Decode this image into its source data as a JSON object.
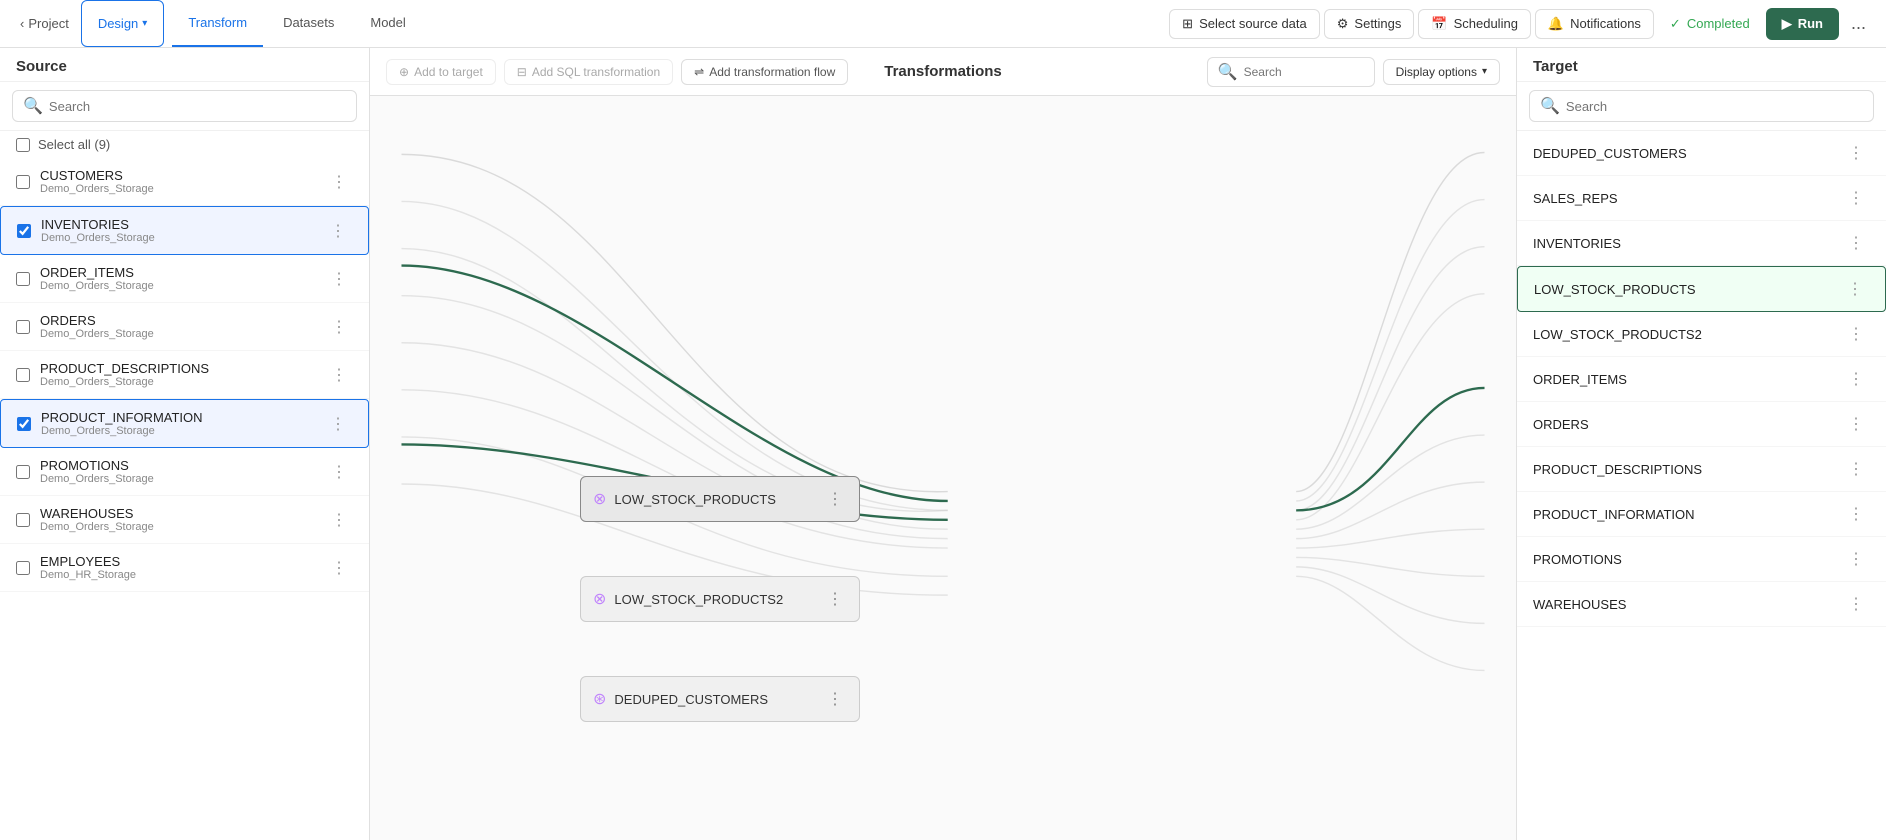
{
  "nav": {
    "back_label": "Project",
    "design_label": "Design",
    "transform_label": "Transform",
    "datasets_label": "Datasets",
    "model_label": "Model",
    "select_source_label": "Select source data",
    "settings_label": "Settings",
    "scheduling_label": "Scheduling",
    "notifications_label": "Notifications",
    "completed_label": "Completed",
    "run_label": "Run",
    "more_label": "..."
  },
  "source": {
    "panel_title": "Source",
    "search_placeholder": "Search",
    "select_all_label": "Select all (9)",
    "items": [
      {
        "name": "CUSTOMERS",
        "sub": "Demo_Orders_Storage",
        "selected": false
      },
      {
        "name": "INVENTORIES",
        "sub": "Demo_Orders_Storage",
        "selected": true
      },
      {
        "name": "ORDER_ITEMS",
        "sub": "Demo_Orders_Storage",
        "selected": false
      },
      {
        "name": "ORDERS",
        "sub": "Demo_Orders_Storage",
        "selected": false
      },
      {
        "name": "PRODUCT_DESCRIPTIONS",
        "sub": "Demo_Orders_Storage",
        "selected": false
      },
      {
        "name": "PRODUCT_INFORMATION",
        "sub": "Demo_Orders_Storage",
        "selected": true
      },
      {
        "name": "PROMOTIONS",
        "sub": "Demo_Orders_Storage",
        "selected": false
      },
      {
        "name": "WAREHOUSES",
        "sub": "Demo_Orders_Storage",
        "selected": false
      },
      {
        "name": "EMPLOYEES",
        "sub": "Demo_HR_Storage",
        "selected": false
      }
    ]
  },
  "transformations": {
    "panel_title": "Transformations",
    "add_to_target_label": "Add to target",
    "add_sql_label": "Add SQL transformation",
    "add_flow_label": "Add transformation flow",
    "search_placeholder": "Search",
    "display_options_label": "Display options",
    "nodes": [
      {
        "name": "LOW_STOCK_PRODUCTS",
        "active": true,
        "icon": "transform"
      },
      {
        "name": "LOW_STOCK_PRODUCTS2",
        "active": false,
        "icon": "transform"
      },
      {
        "name": "DEDUPED_CUSTOMERS",
        "active": false,
        "icon": "dedup"
      }
    ]
  },
  "target": {
    "panel_title": "Target",
    "search_placeholder": "Search",
    "items": [
      {
        "name": "DEDUPED_CUSTOMERS",
        "selected": false
      },
      {
        "name": "SALES_REPS",
        "selected": false
      },
      {
        "name": "INVENTORIES",
        "selected": false
      },
      {
        "name": "LOW_STOCK_PRODUCTS",
        "selected": true
      },
      {
        "name": "LOW_STOCK_PRODUCTS2",
        "selected": false
      },
      {
        "name": "ORDER_ITEMS",
        "selected": false
      },
      {
        "name": "ORDERS",
        "selected": false
      },
      {
        "name": "PRODUCT_DESCRIPTIONS",
        "selected": false
      },
      {
        "name": "PRODUCT_INFORMATION",
        "selected": false
      },
      {
        "name": "PROMOTIONS",
        "selected": false
      },
      {
        "name": "WAREHOUSES",
        "selected": false
      }
    ]
  },
  "colors": {
    "active_green": "#2d6a4f",
    "selected_border": "#1a73e8",
    "completed_green": "#34a853"
  }
}
